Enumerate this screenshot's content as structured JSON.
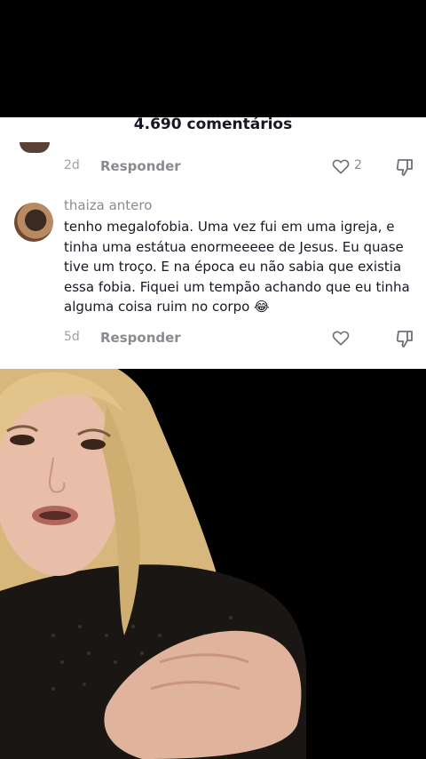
{
  "header": {
    "comment_count_title": "4.690 comentários"
  },
  "comments": [
    {
      "date": "2d",
      "reply_label": "Responder",
      "likes": "2"
    },
    {
      "username": "thaiza antero",
      "text": "tenho megalofobia. Uma vez fui em uma igreja, e tinha uma estátua enormeeeee de Jesus. Eu quase tive um troço. E na época eu não sabia que existia essa fobia. Fiquei um tempão achando que eu tinha alguma coisa ruim no corpo 😂",
      "date": "5d",
      "reply_label": "Responder"
    }
  ],
  "icons": {
    "heart": "heart-outline-icon",
    "dislike": "thumbs-down-icon"
  },
  "colors": {
    "panel_bg": "#ffffff",
    "text_primary": "#161823",
    "text_secondary": "#8a8b91"
  }
}
